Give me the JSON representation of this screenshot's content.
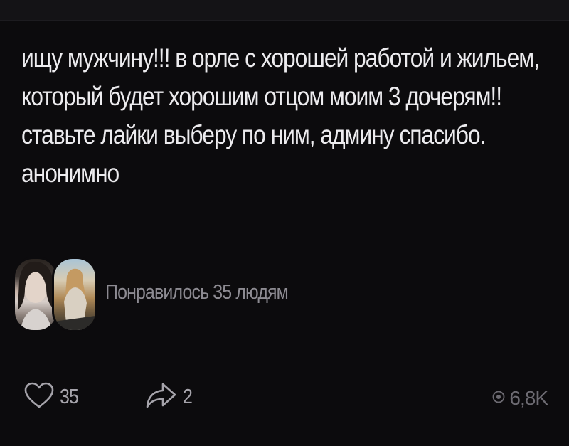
{
  "post": {
    "text": "ищу мужчину!!! в орле с хорошей работой и жильем, который будет хорошим отцом моим 3 дочерям!! ставьте лайки выберу по ним, админу спасибо. анонимно"
  },
  "likers": {
    "label": "Понравилось 35 людям"
  },
  "actions": {
    "like_icon": "heart-icon",
    "like_count": "35",
    "share_icon": "share-arrow-icon",
    "share_count": "2",
    "views_icon": "eye-icon",
    "views_count": "6,8K"
  },
  "colors": {
    "background": "#0c0b0d",
    "text": "#ecebee",
    "muted": "#8d8b92"
  }
}
